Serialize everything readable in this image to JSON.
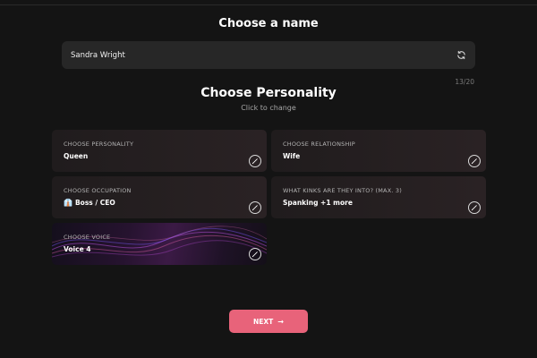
{
  "name_section": {
    "title": "Choose a name",
    "name_value": "Sandra Wright",
    "char_count": "13/20",
    "refresh_icon": "refresh-icon"
  },
  "personality_section": {
    "title": "Choose Personality",
    "subtitle": "Click to change"
  },
  "cards": [
    {
      "label": "CHOOSE PERSONALITY",
      "value": "Queen",
      "icon": "edit-icon"
    },
    {
      "label": "CHOOSE RELATIONSHIP",
      "value": "Wife",
      "icon": "edit-icon"
    },
    {
      "label": "CHOOSE OCCUPATION",
      "value": "Boss / CEO",
      "emoji": "👔",
      "icon": "edit-icon"
    },
    {
      "label": "WHAT KINKS ARE THEY INTO? (MAX. 3)",
      "value": "Spanking +1 more",
      "icon": "edit-icon"
    },
    {
      "label": "CHOOSE VOICE",
      "value": "Voice 4",
      "icon": "edit-icon"
    }
  ],
  "next_button": {
    "label": "NEXT",
    "arrow": "→"
  },
  "colors": {
    "background": "#141414",
    "field": "#272727",
    "card": "#241e20",
    "accent": "#e8637a"
  }
}
